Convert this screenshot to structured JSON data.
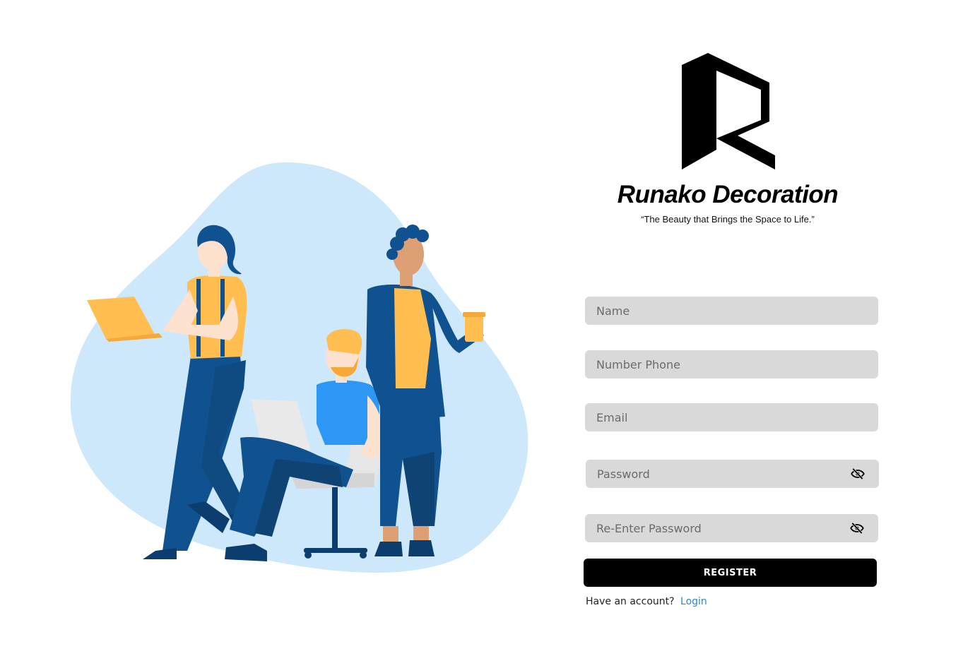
{
  "brand": {
    "name": "Runako Decoration",
    "tagline": "“The Beauty that Brings the Space to Life.”",
    "logo_icon": "r-logo-icon"
  },
  "illustration": {
    "icon": "team-working-illustration"
  },
  "form": {
    "name": {
      "placeholder": "Name",
      "value": ""
    },
    "phone": {
      "placeholder": "Number Phone",
      "value": ""
    },
    "email": {
      "placeholder": "Email",
      "value": ""
    },
    "password": {
      "placeholder": "Password",
      "value": "",
      "toggle_icon": "eye-off-icon"
    },
    "repassword": {
      "placeholder": "Re-Enter Password",
      "value": "",
      "toggle_icon": "eye-off-icon"
    },
    "register_label": "REGISTER"
  },
  "login": {
    "prompt": "Have an account?",
    "link_label": "Login"
  },
  "colors": {
    "field_bg": "#d9d9d9",
    "button_bg": "#000000",
    "link": "#2a86d6",
    "blob": "#cde7fb",
    "navy": "#10518f",
    "yellow": "#ffbe4f",
    "blue_shirt": "#2d97f5"
  }
}
